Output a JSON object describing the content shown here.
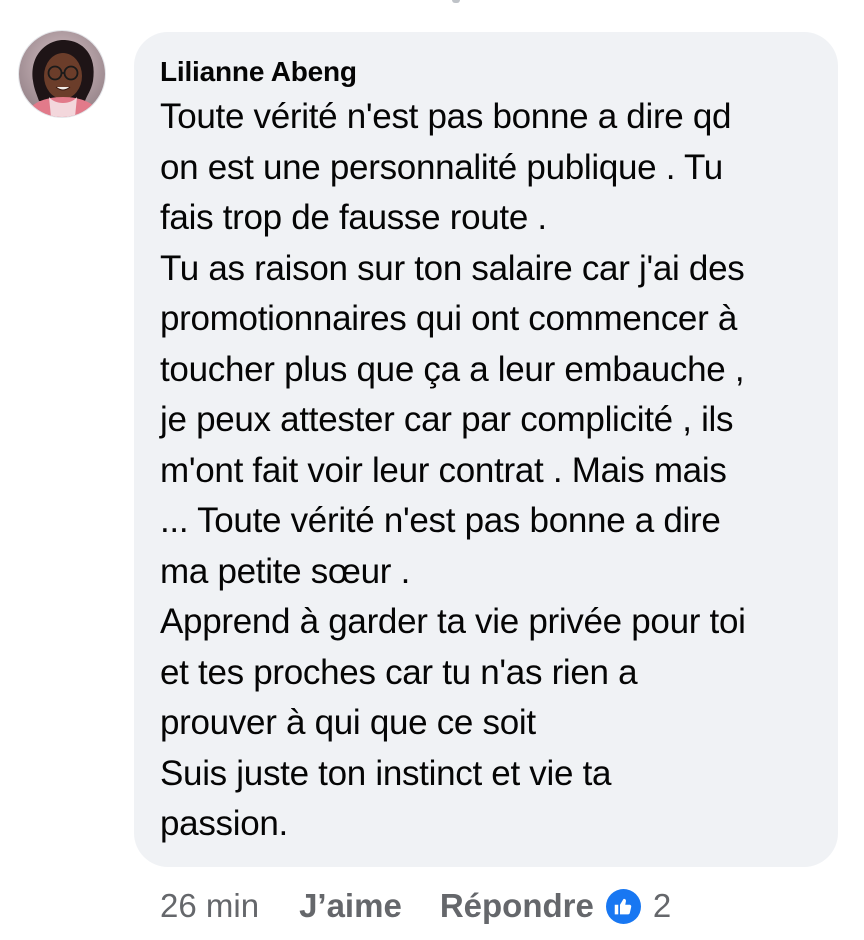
{
  "comment": {
    "author": "Lilianne Abeng",
    "avatar_icon": "profile-photo",
    "text_lines": [
      "Toute vérité n'est pas bonne a dire qd",
      "on est une personnalité publique . Tu",
      "fais trop de fausse route .",
      "Tu as raison sur ton salaire car j'ai des",
      "promotionnaires qui ont commencer à",
      "toucher plus que ça a leur embauche ,",
      "je peux attester car par complicité , ils",
      "m'ont fait voir leur contrat . Mais mais",
      "... Toute vérité n'est pas bonne a dire",
      "ma petite sœur .",
      "Apprend à garder ta vie privée pour toi",
      "et tes proches car tu n'as rien a",
      "prouver à qui que ce soit",
      "Suis juste ton instinct et vie ta",
      "passion."
    ]
  },
  "actions": {
    "timestamp": "26 min",
    "like_label": "J’aime",
    "reply_label": "Répondre",
    "reaction_icon": "thumbs-up-icon",
    "reaction_count": "2"
  },
  "colors": {
    "bubble_background": "#f0f2f5",
    "text": "#050505",
    "secondary_text": "#65676b",
    "like_blue": "#1877f2"
  }
}
